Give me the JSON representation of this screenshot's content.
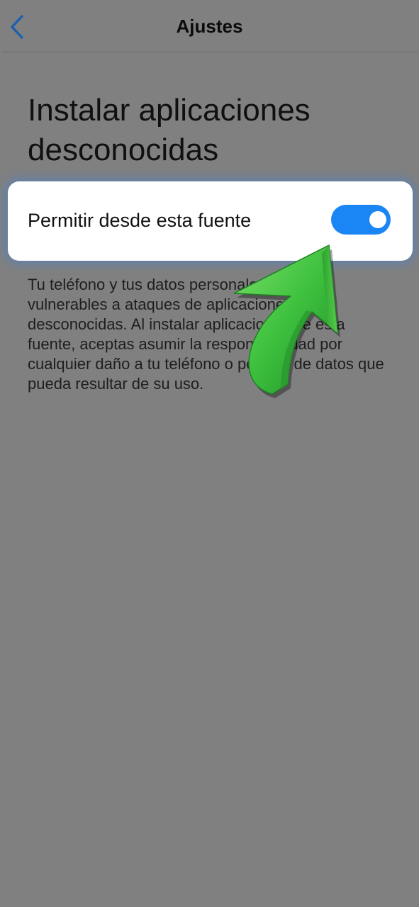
{
  "header": {
    "back_icon": "chevron-left-icon",
    "title": "Ajustes"
  },
  "page": {
    "title": "Instalar aplicaciones desconocidas"
  },
  "setting": {
    "label": "Permitir desde esta fuente",
    "toggle_state": "on"
  },
  "description": "Tu teléfono y tus datos personales son más vulnerables a ataques de aplicaciones desconocidas. Al instalar aplicaciones de esta fuente, aceptas asumir la responsabilidad por cualquier daño a tu teléfono o pérdida de datos que pueda resultar de su uso.",
  "annotation": {
    "icon": "green-arrow-icon"
  },
  "colors": {
    "background": "#808080",
    "accent": "#1a86f5",
    "back_icon": "#1a5fb0",
    "arrow": "#3ec13e"
  }
}
